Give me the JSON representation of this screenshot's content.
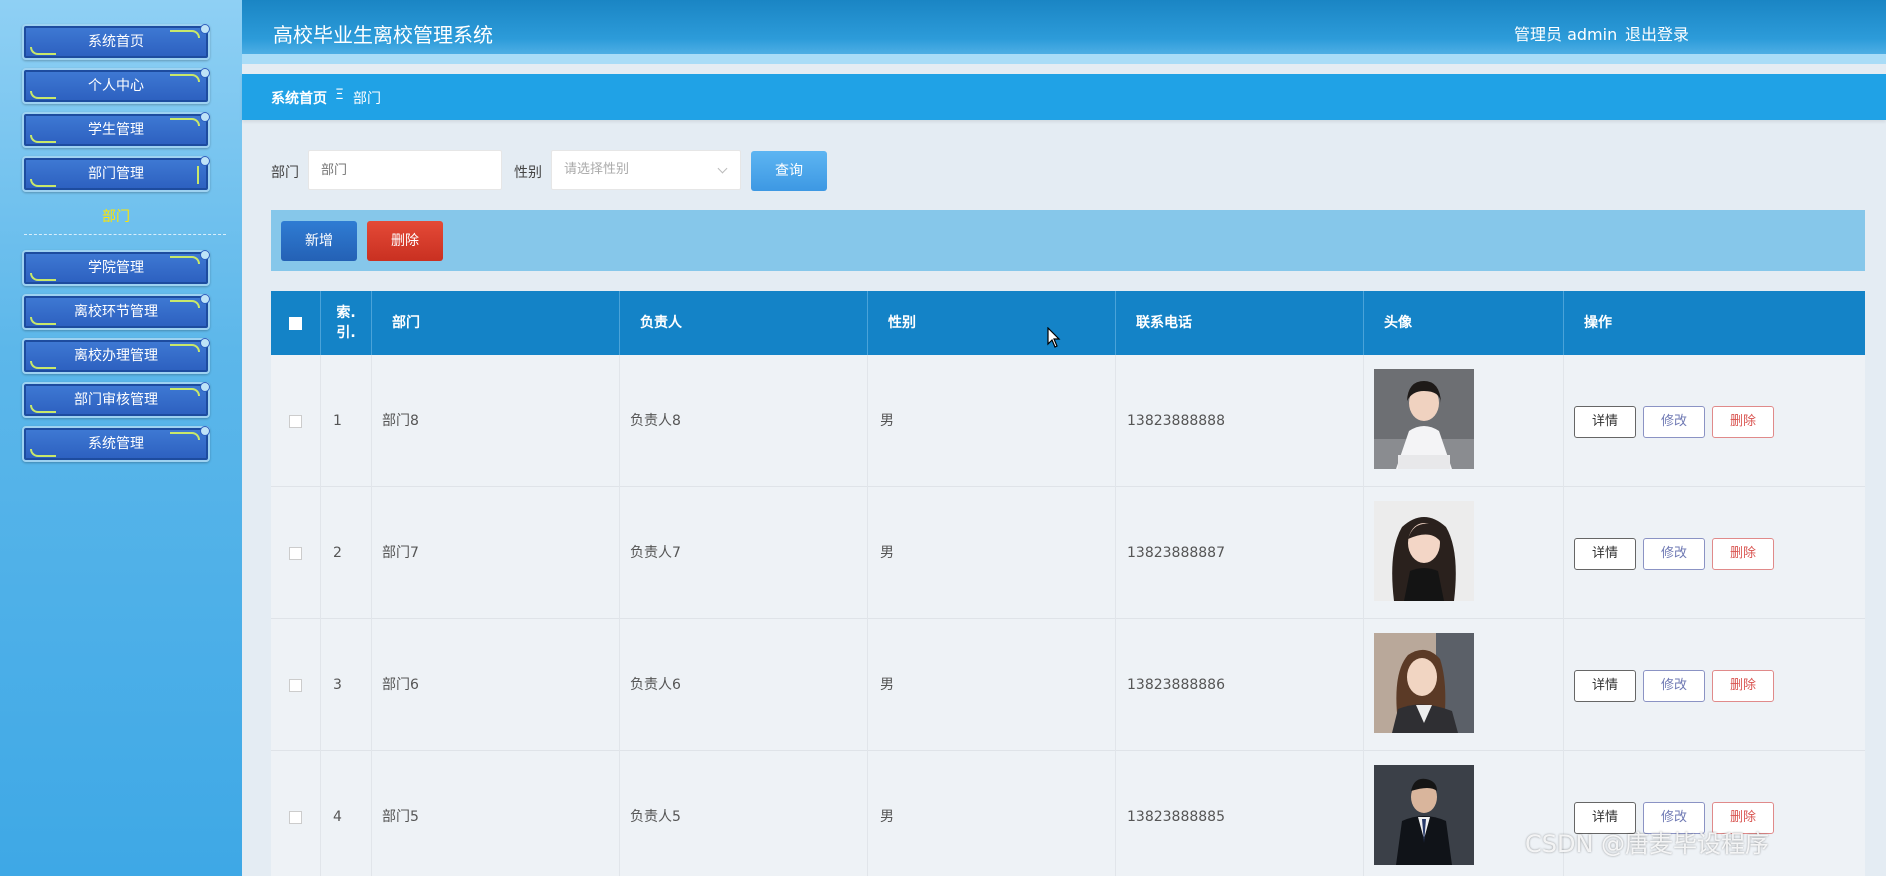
{
  "header": {
    "app_title": "高校毕业生离校管理系统",
    "user_info": "管理员 admin",
    "logout_label": "退出登录"
  },
  "sidebar": {
    "items": [
      {
        "label": "系统首页"
      },
      {
        "label": "个人中心"
      },
      {
        "label": "学生管理"
      },
      {
        "label": "部门管理"
      },
      {
        "label": "学院管理"
      },
      {
        "label": "离校环节管理"
      },
      {
        "label": "离校办理管理"
      },
      {
        "label": "部门审核管理"
      },
      {
        "label": "系统管理"
      }
    ],
    "sub_item": {
      "label": "部门"
    }
  },
  "breadcrumb": {
    "home": "系统首页",
    "separator": "Ξ",
    "current": "部门"
  },
  "search": {
    "dept_label": "部门",
    "dept_placeholder": "部门",
    "gender_label": "性别",
    "gender_placeholder": "请选择性别",
    "query_label": "查询"
  },
  "actions": {
    "add_label": "新增",
    "delete_label": "删除"
  },
  "table": {
    "columns": [
      "索引",
      "部门",
      "负责人",
      "性别",
      "联系电话",
      "头像",
      "操作"
    ],
    "index_header_line1": "索.",
    "index_header_line2": "引.",
    "rows": [
      {
        "index": "1",
        "dept": "部门8",
        "leader": "负责人8",
        "gender": "男",
        "phone": "13823888888"
      },
      {
        "index": "2",
        "dept": "部门7",
        "leader": "负责人7",
        "gender": "男",
        "phone": "13823888887"
      },
      {
        "index": "3",
        "dept": "部门6",
        "leader": "负责人6",
        "gender": "男",
        "phone": "13823888886"
      },
      {
        "index": "4",
        "dept": "部门5",
        "leader": "负责人5",
        "gender": "男",
        "phone": "13823888885"
      }
    ],
    "op_detail": "详情",
    "op_edit": "修改",
    "op_delete": "删除"
  },
  "watermark": "CSDN @唐麦毕设程序",
  "colors": {
    "primary": "#1483c7",
    "header": "#2c9bd9",
    "breadcrumb": "#20a2e6",
    "add_button": "#2a6fc4",
    "delete_button": "#d93a2b",
    "query_button": "#4ba7ec",
    "highlight": "#ffe600"
  }
}
